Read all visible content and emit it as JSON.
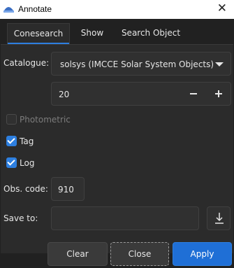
{
  "window": {
    "title": "Annotate",
    "close_glyph": "✕"
  },
  "tabs": [
    {
      "label": "Conesearch",
      "active": true
    },
    {
      "label": "Show",
      "active": false
    },
    {
      "label": "Search Object",
      "active": false
    }
  ],
  "form": {
    "catalogue_label": "Catalogue:",
    "catalogue_value": "solsys (IMCCE Solar System Objects)",
    "radius_value": "20",
    "photometric_label": "Photometric",
    "photometric_checked": false,
    "tag_label": "Tag",
    "tag_checked": true,
    "log_label": "Log",
    "log_checked": true,
    "obs_code_label": "Obs. code:",
    "obs_code_value": "910",
    "save_to_label": "Save to:",
    "save_to_value": ""
  },
  "buttons": {
    "clear": "Clear",
    "close": "Close",
    "apply": "Apply"
  },
  "colors": {
    "accent": "#2d7fe0",
    "background": "#212121",
    "panel": "#2b2b2b"
  },
  "icons": [
    "app-icon",
    "close-icon",
    "chevron-down-icon",
    "minus-icon",
    "plus-icon",
    "checkmark-icon",
    "download-icon"
  ]
}
